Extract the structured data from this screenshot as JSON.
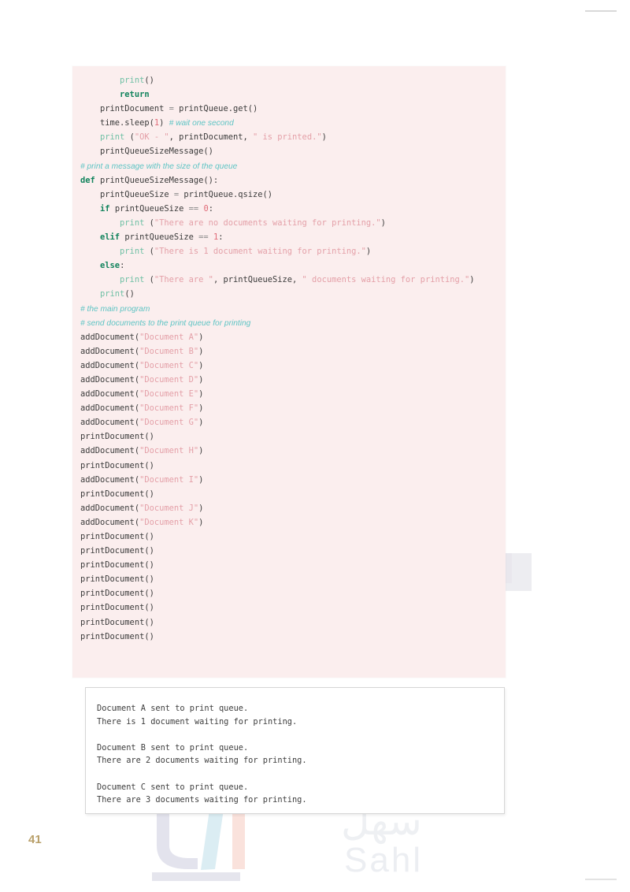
{
  "document": {
    "page_number": "41",
    "watermark": {
      "brand_latin": "Sahl",
      "brand_arabic": "سهل"
    }
  },
  "code_block": {
    "language": "python",
    "lines": [
      {
        "indent": 2,
        "tokens": [
          {
            "t": "fn",
            "v": "print"
          },
          {
            "t": "plain",
            "v": "()"
          }
        ]
      },
      {
        "indent": 2,
        "tokens": [
          {
            "t": "kw",
            "v": "return"
          }
        ]
      },
      {
        "indent": 1,
        "tokens": [
          {
            "t": "plain",
            "v": "printDocument "
          },
          {
            "t": "op",
            "v": "= "
          },
          {
            "t": "plain",
            "v": "printQueue.get()"
          }
        ]
      },
      {
        "indent": 1,
        "tokens": [
          {
            "t": "plain",
            "v": "time.sleep("
          },
          {
            "t": "num",
            "v": "1"
          },
          {
            "t": "plain",
            "v": ") "
          },
          {
            "t": "cmt",
            "v": "# wait one second"
          }
        ]
      },
      {
        "indent": 1,
        "tokens": [
          {
            "t": "fn",
            "v": "print "
          },
          {
            "t": "plain",
            "v": "("
          },
          {
            "t": "str",
            "v": "\"OK - \""
          },
          {
            "t": "plain",
            "v": ", printDocument, "
          },
          {
            "t": "str",
            "v": "\" is printed.\""
          },
          {
            "t": "plain",
            "v": ")"
          }
        ]
      },
      {
        "indent": 1,
        "tokens": [
          {
            "t": "plain",
            "v": "printQueueSizeMessage()"
          }
        ]
      },
      {
        "indent": 0,
        "tokens": [
          {
            "t": "cmt",
            "v": "# print a message with the size of the queue"
          }
        ]
      },
      {
        "indent": 0,
        "tokens": [
          {
            "t": "kw",
            "v": "def "
          },
          {
            "t": "plain",
            "v": "printQueueSizeMessage():"
          }
        ]
      },
      {
        "indent": 1,
        "tokens": [
          {
            "t": "plain",
            "v": "printQueueSize "
          },
          {
            "t": "op",
            "v": "= "
          },
          {
            "t": "plain",
            "v": "printQueue.qsize()"
          }
        ]
      },
      {
        "indent": 1,
        "tokens": [
          {
            "t": "kw",
            "v": "if "
          },
          {
            "t": "plain",
            "v": "printQueueSize "
          },
          {
            "t": "op",
            "v": "== "
          },
          {
            "t": "num",
            "v": "0"
          },
          {
            "t": "plain",
            "v": ":"
          }
        ]
      },
      {
        "indent": 2,
        "tokens": [
          {
            "t": "fn",
            "v": "print "
          },
          {
            "t": "plain",
            "v": "("
          },
          {
            "t": "str",
            "v": "\"There are no documents waiting for printing.\""
          },
          {
            "t": "plain",
            "v": ")"
          }
        ]
      },
      {
        "indent": 1,
        "tokens": [
          {
            "t": "kw",
            "v": "elif "
          },
          {
            "t": "plain",
            "v": "printQueueSize "
          },
          {
            "t": "op",
            "v": "== "
          },
          {
            "t": "num",
            "v": "1"
          },
          {
            "t": "plain",
            "v": ":"
          }
        ]
      },
      {
        "indent": 2,
        "tokens": [
          {
            "t": "fn",
            "v": "print "
          },
          {
            "t": "plain",
            "v": "("
          },
          {
            "t": "str",
            "v": "\"There is 1 document waiting for printing.\""
          },
          {
            "t": "plain",
            "v": ")"
          }
        ]
      },
      {
        "indent": 1,
        "tokens": [
          {
            "t": "kw",
            "v": "else"
          },
          {
            "t": "plain",
            "v": ":"
          }
        ]
      },
      {
        "indent": 2,
        "tokens": [
          {
            "t": "fn",
            "v": "print "
          },
          {
            "t": "plain",
            "v": "("
          },
          {
            "t": "str",
            "v": "\"There are \""
          },
          {
            "t": "plain",
            "v": ", printQueueSize, "
          },
          {
            "t": "str",
            "v": "\" documents waiting for printing.\""
          },
          {
            "t": "plain",
            "v": ")"
          }
        ]
      },
      {
        "indent": 1,
        "tokens": [
          {
            "t": "fn",
            "v": "print"
          },
          {
            "t": "plain",
            "v": "()"
          }
        ]
      },
      {
        "indent": 0,
        "tokens": [
          {
            "t": "cmt",
            "v": "# the main program"
          }
        ]
      },
      {
        "indent": 0,
        "tokens": [
          {
            "t": "cmt",
            "v": "# send documents to the print queue for printing"
          }
        ]
      },
      {
        "indent": 0,
        "tokens": [
          {
            "t": "plain",
            "v": "addDocument("
          },
          {
            "t": "str",
            "v": "\"Document A\""
          },
          {
            "t": "plain",
            "v": ")"
          }
        ]
      },
      {
        "indent": 0,
        "tokens": [
          {
            "t": "plain",
            "v": "addDocument("
          },
          {
            "t": "str",
            "v": "\"Document B\""
          },
          {
            "t": "plain",
            "v": ")"
          }
        ]
      },
      {
        "indent": 0,
        "tokens": [
          {
            "t": "plain",
            "v": "addDocument("
          },
          {
            "t": "str",
            "v": "\"Document C\""
          },
          {
            "t": "plain",
            "v": ")"
          }
        ]
      },
      {
        "indent": 0,
        "tokens": [
          {
            "t": "plain",
            "v": "addDocument("
          },
          {
            "t": "str",
            "v": "\"Document D\""
          },
          {
            "t": "plain",
            "v": ")"
          }
        ]
      },
      {
        "indent": 0,
        "tokens": [
          {
            "t": "plain",
            "v": "addDocument("
          },
          {
            "t": "str",
            "v": "\"Document E\""
          },
          {
            "t": "plain",
            "v": ")"
          }
        ]
      },
      {
        "indent": 0,
        "tokens": [
          {
            "t": "plain",
            "v": "addDocument("
          },
          {
            "t": "str",
            "v": "\"Document F\""
          },
          {
            "t": "plain",
            "v": ")"
          }
        ]
      },
      {
        "indent": 0,
        "tokens": [
          {
            "t": "plain",
            "v": "addDocument("
          },
          {
            "t": "str",
            "v": "\"Document G\""
          },
          {
            "t": "plain",
            "v": ")"
          }
        ]
      },
      {
        "indent": 0,
        "tokens": [
          {
            "t": "plain",
            "v": "printDocument()"
          }
        ]
      },
      {
        "indent": 0,
        "tokens": [
          {
            "t": "plain",
            "v": "addDocument("
          },
          {
            "t": "str",
            "v": "\"Document H\""
          },
          {
            "t": "plain",
            "v": ")"
          }
        ]
      },
      {
        "indent": 0,
        "tokens": [
          {
            "t": "plain",
            "v": "printDocument()"
          }
        ]
      },
      {
        "indent": 0,
        "tokens": [
          {
            "t": "plain",
            "v": "addDocument("
          },
          {
            "t": "str",
            "v": "\"Document I\""
          },
          {
            "t": "plain",
            "v": ")"
          }
        ]
      },
      {
        "indent": 0,
        "tokens": [
          {
            "t": "plain",
            "v": "printDocument()"
          }
        ]
      },
      {
        "indent": 0,
        "tokens": [
          {
            "t": "plain",
            "v": "addDocument("
          },
          {
            "t": "str",
            "v": "\"Document J\""
          },
          {
            "t": "plain",
            "v": ")"
          }
        ]
      },
      {
        "indent": 0,
        "tokens": [
          {
            "t": "plain",
            "v": "addDocument("
          },
          {
            "t": "str",
            "v": "\"Document K\""
          },
          {
            "t": "plain",
            "v": ")"
          }
        ]
      },
      {
        "indent": 0,
        "tokens": [
          {
            "t": "plain",
            "v": "printDocument()"
          }
        ]
      },
      {
        "indent": 0,
        "tokens": [
          {
            "t": "plain",
            "v": "printDocument()"
          }
        ]
      },
      {
        "indent": 0,
        "tokens": [
          {
            "t": "plain",
            "v": "printDocument()"
          }
        ]
      },
      {
        "indent": 0,
        "tokens": [
          {
            "t": "plain",
            "v": "printDocument()"
          }
        ]
      },
      {
        "indent": 0,
        "tokens": [
          {
            "t": "plain",
            "v": "printDocument()"
          }
        ]
      },
      {
        "indent": 0,
        "tokens": [
          {
            "t": "plain",
            "v": "printDocument()"
          }
        ]
      },
      {
        "indent": 0,
        "tokens": [
          {
            "t": "plain",
            "v": "printDocument()"
          }
        ]
      },
      {
        "indent": 0,
        "tokens": [
          {
            "t": "plain",
            "v": "printDocument()"
          }
        ]
      }
    ]
  },
  "output_box": {
    "lines": [
      "Document A sent to print queue.",
      "There is 1 document waiting for printing.",
      "",
      "Document B sent to print queue.",
      "There are 2 documents waiting for printing.",
      "",
      "Document C sent to print queue.",
      "There are 3 documents waiting for printing."
    ]
  },
  "colors": {
    "code_background": "#fbeeee",
    "keyword": "#11835c",
    "function": "#6fc0a5",
    "string": "#e4a0a8",
    "number": "#e06b78",
    "comment": "#5ec4c4",
    "plain_text": "#3b3b3b",
    "page_number": "#b9a06a",
    "output_border": "#d6d6d6"
  }
}
